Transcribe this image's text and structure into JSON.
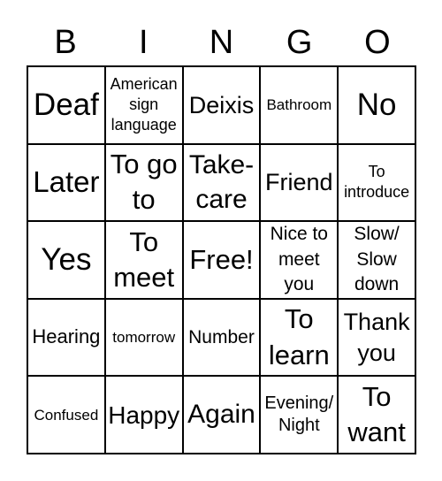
{
  "header": [
    "B",
    "I",
    "N",
    "G",
    "O"
  ],
  "cells": [
    "Deaf",
    "American sign language",
    "Deixis",
    "Bathroom",
    "No",
    "Later",
    "To go to",
    "Take-care",
    "Friend",
    "To introduce",
    "Yes",
    "To meet",
    "Free!",
    "Nice to meet you",
    "Slow/ Slow down",
    "Hearing",
    "tomorrow",
    "Number",
    "To learn",
    "Thank you",
    "Confused",
    "Happy",
    "Again",
    "Evening/ Night",
    "To want"
  ]
}
